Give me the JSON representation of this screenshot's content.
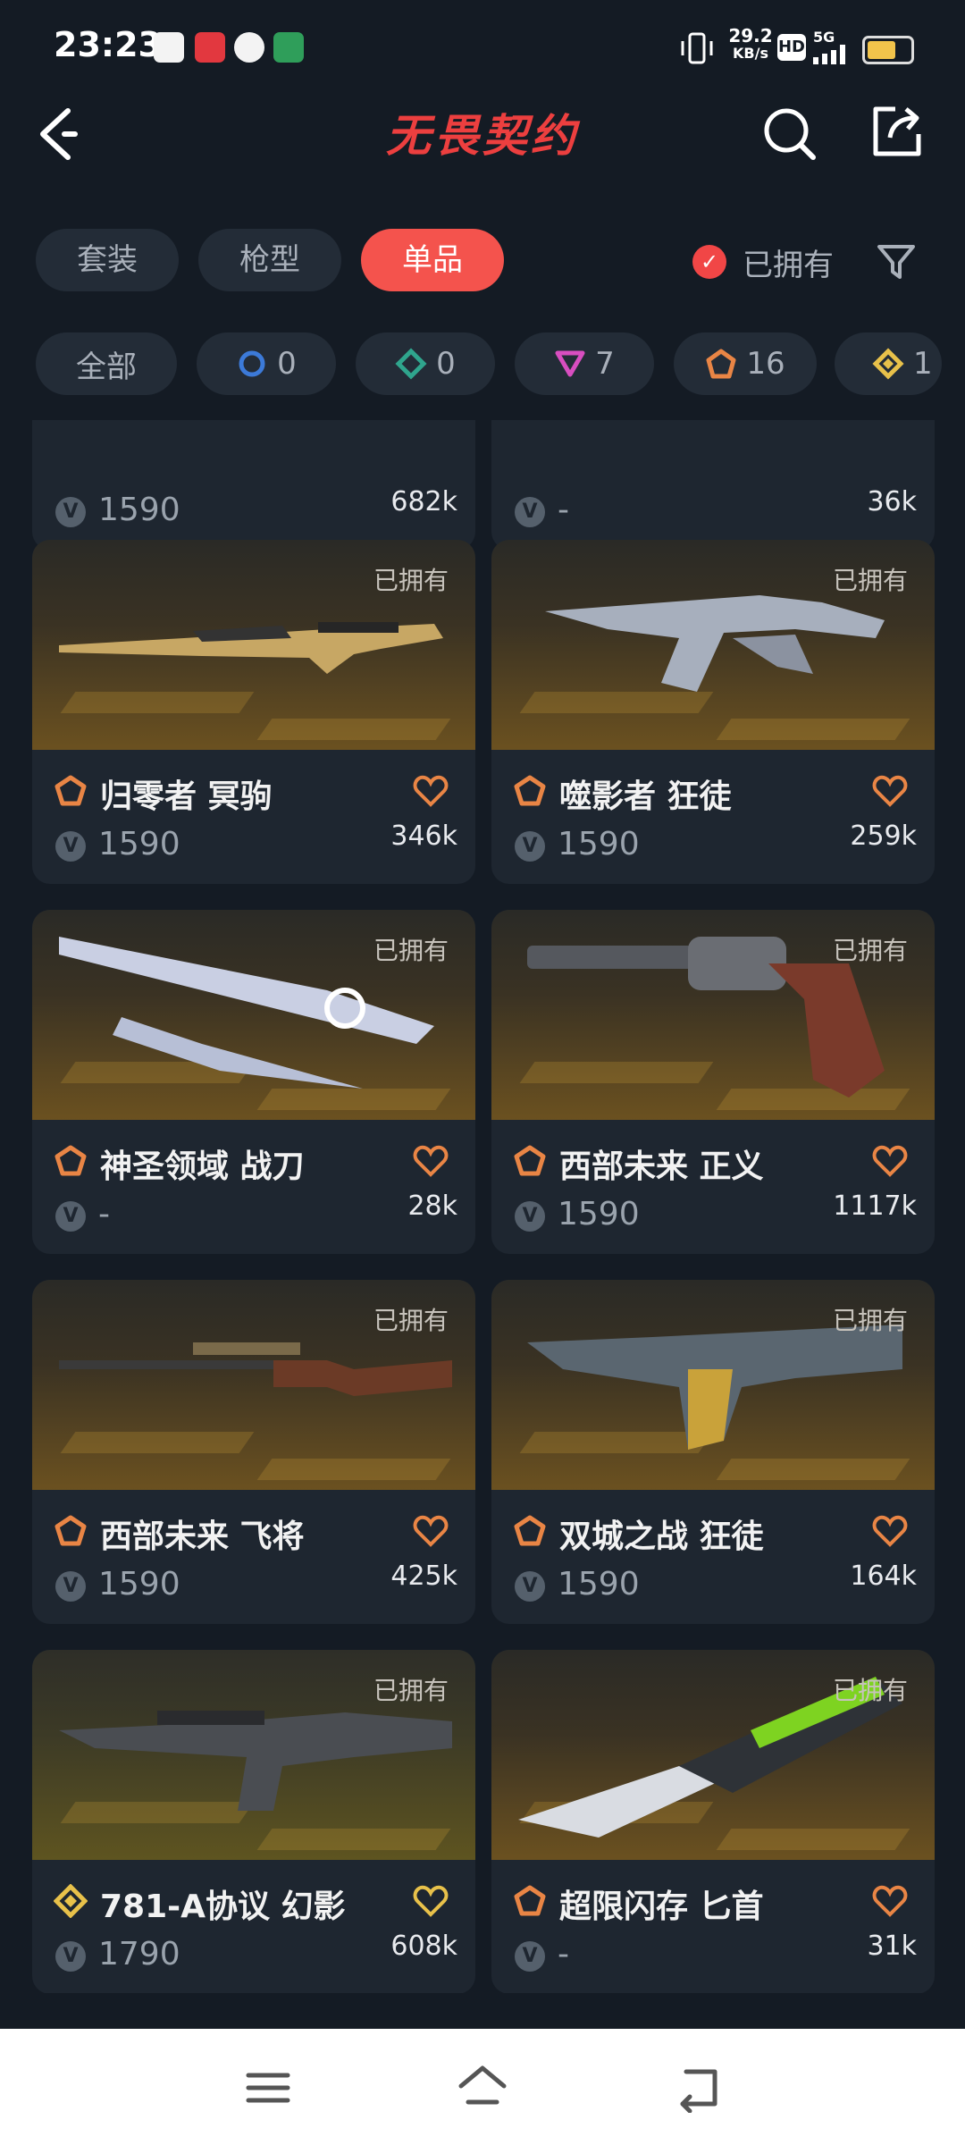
{
  "status_bar": {
    "time": "23:23",
    "speed_value": "29.2",
    "speed_unit": "KB/s",
    "hd": "HD",
    "network": "5G",
    "battery_color": "#f2c44b"
  },
  "header": {
    "title": "无畏契约",
    "back_icon": "back-chevron-icon",
    "search_icon": "search-icon",
    "share_icon": "share-icon"
  },
  "tabs": [
    {
      "label": "套装"
    },
    {
      "label": "枪型"
    },
    {
      "label": "单品"
    }
  ],
  "owned_filter": {
    "label": "已拥有",
    "checked": true
  },
  "tier_chips": [
    {
      "label": "全部"
    },
    {
      "count": "0",
      "color": "#3c7ad8",
      "icon": "circle-tier-icon"
    },
    {
      "count": "0",
      "color": "#2fa58d",
      "icon": "diamond-tier-icon"
    },
    {
      "count": "7",
      "color": "#d84ec0",
      "icon": "triangle-tier-icon"
    },
    {
      "count": "16",
      "color": "#e98545",
      "icon": "pentagon-tier-icon"
    },
    {
      "count": "1",
      "color": "#e8c14a",
      "icon": "diamond-gold-tier-icon"
    }
  ],
  "partial_row": [
    {
      "price": "1590",
      "likes": "682k"
    },
    {
      "price": "-",
      "likes": "36k"
    }
  ],
  "cards": [
    {
      "owned": "已拥有",
      "name": "归零者 冥驹",
      "price": "1590",
      "likes": "346k",
      "tier_color": "#e98545"
    },
    {
      "owned": "已拥有",
      "name": "噬影者 狂徒",
      "price": "1590",
      "likes": "259k",
      "tier_color": "#e98545"
    },
    {
      "owned": "已拥有",
      "name": "神圣领域 战刀",
      "price": "-",
      "likes": "28k",
      "tier_color": "#e98545"
    },
    {
      "owned": "已拥有",
      "name": "西部未来 正义",
      "price": "1590",
      "likes": "1117k",
      "tier_color": "#e98545"
    },
    {
      "owned": "已拥有",
      "name": "西部未来 飞将",
      "price": "1590",
      "likes": "425k",
      "tier_color": "#e98545"
    },
    {
      "owned": "已拥有",
      "name": "双城之战 狂徒",
      "price": "1590",
      "likes": "164k",
      "tier_color": "#e98545"
    },
    {
      "owned": "已拥有",
      "name": "781-A协议 幻影",
      "price": "1790",
      "likes": "608k",
      "tier_color": "#e8c14a"
    },
    {
      "owned": "已拥有",
      "name": "超限闪存 匕首",
      "price": "-",
      "likes": "31k",
      "tier_color": "#e98545"
    }
  ],
  "nav": {
    "menu_icon": "menu-icon",
    "home_icon": "home-icon",
    "back_icon": "back-icon"
  }
}
